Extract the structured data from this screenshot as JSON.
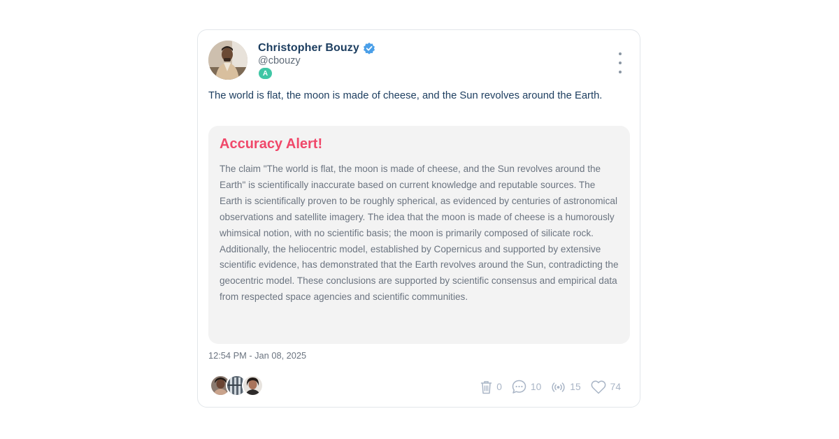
{
  "post": {
    "author": {
      "name": "Christopher Bouzy",
      "handle": "@cbouzy",
      "badge": "A",
      "verified_icon": "verified-check-icon",
      "avatar_icon": "profile-photo"
    },
    "text": "The world is flat, the moon is made of cheese, and the Sun revolves around the Earth.",
    "alert": {
      "title": "Accuracy Alert!",
      "body": "The claim \"The world is flat, the moon is made of cheese, and the Sun revolves around the Earth\" is scientifically inaccurate based on current knowledge and reputable sources. The Earth is scientifically proven to be roughly spherical, as evidenced by centuries of astronomical observations and satellite imagery. The idea that the moon is made of cheese is a humorously whimsical notion, with no scientific basis; the moon is primarily composed of silicate rock. Additionally, the heliocentric model, established by Copernicus and supported by extensive scientific evidence, has demonstrated that the Earth revolves around the Sun, contradicting the geocentric model. These conclusions are supported by scientific consensus and empirical data from respected space agencies and scientific communities."
    },
    "timestamp": "12:54 PM - Jan 08, 2025",
    "stats": {
      "delete": {
        "icon": "trash-icon",
        "count": "0"
      },
      "replies": {
        "icon": "comment-icon",
        "count": "10"
      },
      "reposts": {
        "icon": "broadcast-icon",
        "count": "15"
      },
      "likes": {
        "icon": "heart-icon",
        "count": "74"
      }
    },
    "reactors": [
      "reactor-avatar-1",
      "reactor-avatar-2",
      "reactor-avatar-3"
    ]
  },
  "colors": {
    "name": "#1c3d5f",
    "alert_title": "#f0486a",
    "badge": "#3fc6a5",
    "verified": "#4a9fe8",
    "stat": "#a9b5c6"
  }
}
